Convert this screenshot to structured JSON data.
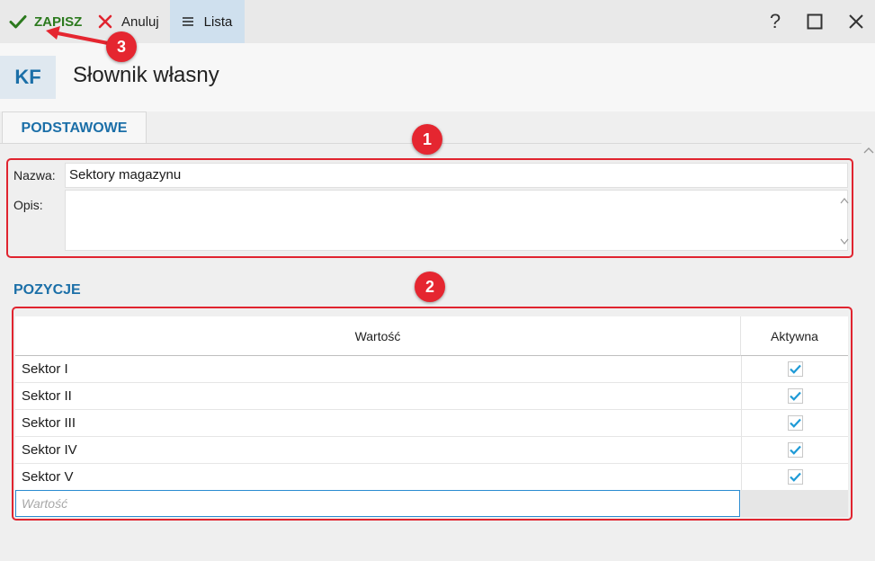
{
  "toolbar": {
    "save_label": "ZAPISZ",
    "cancel_label": "Anuluj",
    "list_label": "Lista",
    "help_label": "?"
  },
  "header": {
    "badge": "KF",
    "title": "Słownik własny"
  },
  "tabs": [
    {
      "label": "PODSTAWOWE",
      "active": true
    }
  ],
  "form": {
    "name_label": "Nazwa:",
    "name_value": "Sektory magazynu",
    "desc_label": "Opis:",
    "desc_value": ""
  },
  "positions": {
    "title": "POZYCJE",
    "columns": [
      "Wartość",
      "Aktywna"
    ],
    "rows": [
      {
        "value": "Sektor I",
        "active": true
      },
      {
        "value": "Sektor II",
        "active": true
      },
      {
        "value": "Sektor III",
        "active": true
      },
      {
        "value": "Sektor IV",
        "active": true
      },
      {
        "value": "Sektor V",
        "active": true
      }
    ],
    "new_row_placeholder": "Wartość"
  },
  "annotations": {
    "badge1": "1",
    "badge2": "2",
    "badge3": "3"
  },
  "colors": {
    "accent_blue": "#1b6fa8",
    "save_green": "#2c7a1e",
    "cancel_red": "#e0242f",
    "check_blue": "#1e9ad6",
    "annotation_red": "#e0242f"
  },
  "icons": {
    "save": "checkmark-icon",
    "cancel": "x-icon",
    "list": "hamburger-icon",
    "maximize": "square-icon",
    "close": "close-icon"
  }
}
